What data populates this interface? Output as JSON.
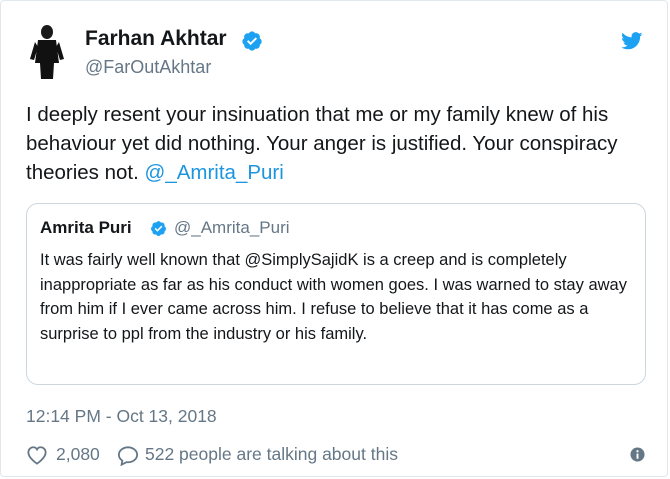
{
  "author": {
    "name": "Farhan Akhtar",
    "handle": "@FarOutAkhtar",
    "verified": true
  },
  "tweet": {
    "text_before_mention": "I deeply resent your insinuation that me or my family knew of his behaviour yet did nothing. Your anger is justified. Your conspiracy theories not. ",
    "mention": "@_Amrita_Puri"
  },
  "quote": {
    "name": "Amrita Puri",
    "handle": "@_Amrita_Puri",
    "verified": true,
    "text": "It was fairly well known that @SimplySajidK is a creep and is completely inappropriate as far as his conduct with women goes. I was warned to stay away from him if I ever came across him. I refuse to believe that it has come as a surprise to ppl from the industry or his family."
  },
  "timestamp": "12:14 PM - Oct 13, 2018",
  "engagement": {
    "likes": "2,080",
    "talking": "522 people are talking about this"
  },
  "icons": {
    "verified": "verified-badge-icon",
    "brand": "twitter-bird-icon",
    "like": "heart-icon",
    "reply": "speech-bubble-icon",
    "info": "info-icon"
  },
  "colors": {
    "accent": "#1da1f2",
    "link": "#1b95e0",
    "muted": "#657786",
    "text": "#14171a"
  }
}
